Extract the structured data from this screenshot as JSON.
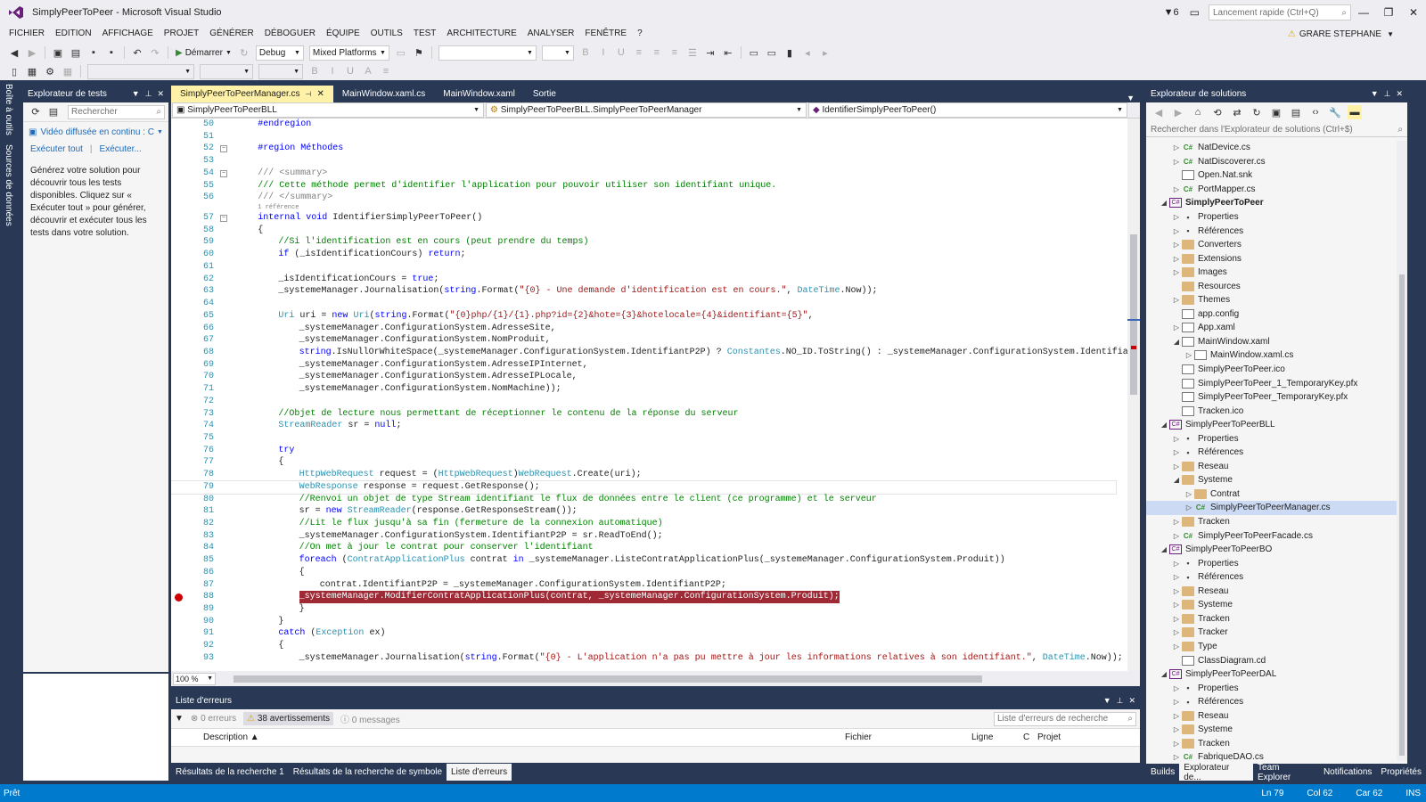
{
  "window": {
    "title": "SimplyPeerToPeer - Microsoft Visual Studio",
    "filter_count": "6",
    "quick_launch": "Lancement rapide (Ctrl+Q)",
    "user": "GRARE STEPHANE"
  },
  "menu": [
    "FICHIER",
    "EDITION",
    "AFFICHAGE",
    "PROJET",
    "GÉNÉRER",
    "DÉBOGUER",
    "ÉQUIPE",
    "OUTILS",
    "TEST",
    "ARCHITECTURE",
    "ANALYSER",
    "FENÊTRE",
    "?"
  ],
  "toolbar": {
    "start_label": "Démarrer",
    "config": "Debug",
    "platform": "Mixed Platforms"
  },
  "side_tabs": [
    "Boîte à outils",
    "Sources de données"
  ],
  "test_explorer": {
    "title": "Explorateur de tests",
    "search_placeholder": "Rechercher",
    "video": "Vidéo diffusée en continu : C",
    "run_all": "Exécuter tout",
    "run": "Exécuter...",
    "description": "Générez votre solution pour découvrir tous les tests disponibles. Cliquez sur « Exécuter tout » pour générer, découvrir et exécuter tous les tests dans votre solution."
  },
  "editor": {
    "tabs": [
      {
        "label": "SimplyPeerToPeerManager.cs",
        "active": true
      },
      {
        "label": "MainWindow.xaml.cs",
        "active": false
      },
      {
        "label": "MainWindow.xaml",
        "active": false
      },
      {
        "label": "Sortie",
        "active": false
      }
    ],
    "nav_project": "SimplyPeerToPeerBLL",
    "nav_class": "SimplyPeerToPeerBLL.SimplyPeerToPeerManager",
    "nav_member": "IdentifierSimplyPeerToPeer()",
    "zoom": "100 %",
    "lines": [
      {
        "n": "50",
        "t": "#endregion",
        "c": "kw",
        "i": 4
      },
      {
        "n": "51",
        "t": "",
        "c": "",
        "i": 0
      },
      {
        "n": "52",
        "t": "#region Méthodes",
        "c": "kw",
        "i": 4,
        "fold": true
      },
      {
        "n": "53",
        "t": "",
        "c": "",
        "i": 0
      },
      {
        "n": "54",
        "t": "/// <summary>",
        "c": "gray",
        "i": 4,
        "fold": true
      },
      {
        "n": "55",
        "t": "/// Cette méthode permet d'identifier l'application pour pouvoir utiliser son identifiant unique.",
        "c": "cmt",
        "i": 4
      },
      {
        "n": "56",
        "t": "/// </summary>",
        "c": "gray",
        "i": 4
      },
      {
        "n": "",
        "t": "1 référence",
        "c": "gray",
        "i": 4,
        "small": true
      },
      {
        "n": "57",
        "t": "internal void IdentifierSimplyPeerToPeer()",
        "c": "",
        "i": 4,
        "fold": true
      },
      {
        "n": "58",
        "t": "{",
        "c": "",
        "i": 4
      },
      {
        "n": "59",
        "t": "//Si l'identification est en cours (peut prendre du temps)",
        "c": "cmt",
        "i": 8
      },
      {
        "n": "60",
        "t": "if (_isIdentificationCours) return;",
        "c": "",
        "i": 8
      },
      {
        "n": "61",
        "t": "",
        "c": "",
        "i": 0
      },
      {
        "n": "62",
        "t": "_isIdentificationCours = true;",
        "c": "",
        "i": 8
      },
      {
        "n": "63",
        "t": "_systemeManager.Journalisation(string.Format(\"{0} - Une demande d'identification est en cours.\", DateTime.Now));",
        "c": "",
        "i": 8
      },
      {
        "n": "64",
        "t": "",
        "c": "",
        "i": 0
      },
      {
        "n": "65",
        "t": "Uri uri = new Uri(string.Format(\"{0}php/{1}/{1}.php?id={2}&hote={3}&hotelocale={4}&identifiant={5}\",",
        "c": "",
        "i": 8
      },
      {
        "n": "66",
        "t": "_systemeManager.ConfigurationSystem.AdresseSite,",
        "c": "",
        "i": 12
      },
      {
        "n": "67",
        "t": "_systemeManager.ConfigurationSystem.NomProduit,",
        "c": "",
        "i": 12
      },
      {
        "n": "68",
        "t": "string.IsNullOrWhiteSpace(_systemeManager.ConfigurationSystem.IdentifiantP2P) ? Constantes.NO_ID.ToString() : _systemeManager.ConfigurationSystem.Identifiant",
        "c": "",
        "i": 12
      },
      {
        "n": "69",
        "t": "_systemeManager.ConfigurationSystem.AdresseIPInternet,",
        "c": "",
        "i": 12
      },
      {
        "n": "70",
        "t": "_systemeManager.ConfigurationSystem.AdresseIPLocale,",
        "c": "",
        "i": 12
      },
      {
        "n": "71",
        "t": "_systemeManager.ConfigurationSystem.NomMachine));",
        "c": "",
        "i": 12
      },
      {
        "n": "72",
        "t": "",
        "c": "",
        "i": 0
      },
      {
        "n": "73",
        "t": "//Objet de lecture nous permettant de réceptionner le contenu de la réponse du serveur",
        "c": "cmt",
        "i": 8
      },
      {
        "n": "74",
        "t": "StreamReader sr = null;",
        "c": "",
        "i": 8
      },
      {
        "n": "75",
        "t": "",
        "c": "",
        "i": 0
      },
      {
        "n": "76",
        "t": "try",
        "c": "kw",
        "i": 8
      },
      {
        "n": "77",
        "t": "{",
        "c": "",
        "i": 8
      },
      {
        "n": "78",
        "t": "HttpWebRequest request = (HttpWebRequest)WebRequest.Create(uri);",
        "c": "",
        "i": 12
      },
      {
        "n": "79",
        "t": "WebResponse response = request.GetResponse();",
        "c": "",
        "i": 12,
        "cur": true
      },
      {
        "n": "80",
        "t": "//Renvoi un objet de type Stream identifiant le flux de données entre le client (ce programme) et le serveur",
        "c": "cmt",
        "i": 12
      },
      {
        "n": "81",
        "t": "sr = new StreamReader(response.GetResponseStream());",
        "c": "",
        "i": 12
      },
      {
        "n": "82",
        "t": "//Lit le flux jusqu'à sa fin (fermeture de la connexion automatique)",
        "c": "cmt",
        "i": 12
      },
      {
        "n": "83",
        "t": "_systemeManager.ConfigurationSystem.IdentifiantP2P = sr.ReadToEnd();",
        "c": "",
        "i": 12
      },
      {
        "n": "84",
        "t": "//On met à jour le contrat pour conserver l'identifiant",
        "c": "cmt",
        "i": 12
      },
      {
        "n": "85",
        "t": "foreach (ContratApplicationPlus contrat in _systemeManager.ListeContratApplicationPlus(_systemeManager.ConfigurationSystem.Produit))",
        "c": "",
        "i": 12
      },
      {
        "n": "86",
        "t": "{",
        "c": "",
        "i": 12
      },
      {
        "n": "87",
        "t": "contrat.IdentifiantP2P = _systemeManager.ConfigurationSystem.IdentifiantP2P;",
        "c": "",
        "i": 16
      },
      {
        "n": "88",
        "t": "_systemeManager.ModifierContratApplicationPlus(contrat, _systemeManager.ConfigurationSystem.Produit);",
        "c": "",
        "i": 12,
        "bp": true
      },
      {
        "n": "89",
        "t": "}",
        "c": "",
        "i": 12
      },
      {
        "n": "90",
        "t": "}",
        "c": "",
        "i": 8
      },
      {
        "n": "91",
        "t": "catch (Exception ex)",
        "c": "",
        "i": 8
      },
      {
        "n": "92",
        "t": "{",
        "c": "",
        "i": 8
      },
      {
        "n": "93",
        "t": "_systemeManager.Journalisation(string.Format(\"{0} - L'application n'a pas pu mettre à jour les informations relatives à son identifiant.\", DateTime.Now));",
        "c": "",
        "i": 12
      }
    ]
  },
  "error_list": {
    "title": "Liste d'erreurs",
    "errors": "0 erreurs",
    "warnings": "38 avertissements",
    "messages": "0 messages",
    "search_placeholder": "Liste d'erreurs de recherche",
    "columns": [
      "Description",
      "Fichier",
      "Ligne",
      "C",
      "Projet"
    ]
  },
  "bottom_tabs": [
    "Résultats de la recherche 1",
    "Résultats de la recherche de symbole",
    "Liste d'erreurs"
  ],
  "solution": {
    "title": "Explorateur de solutions",
    "search_placeholder": "Rechercher dans l'Explorateur de solutions (Ctrl+$)",
    "nodes": [
      {
        "l": "NatDevice.cs",
        "d": 2,
        "icon": "cs",
        "a": "r"
      },
      {
        "l": "NatDiscoverer.cs",
        "d": 2,
        "icon": "cs",
        "a": "r"
      },
      {
        "l": "Open.Nat.snk",
        "d": 2,
        "icon": "file",
        "a": ""
      },
      {
        "l": "PortMapper.cs",
        "d": 2,
        "icon": "cs",
        "a": "r"
      },
      {
        "l": "SimplyPeerToPeer",
        "d": 1,
        "icon": "proj",
        "a": "d",
        "b": true
      },
      {
        "l": "Properties",
        "d": 2,
        "icon": "ref",
        "a": "r"
      },
      {
        "l": "Références",
        "d": 2,
        "icon": "ref",
        "a": "r"
      },
      {
        "l": "Converters",
        "d": 2,
        "icon": "folder",
        "a": "r"
      },
      {
        "l": "Extensions",
        "d": 2,
        "icon": "folder",
        "a": "r"
      },
      {
        "l": "Images",
        "d": 2,
        "icon": "folder",
        "a": "r"
      },
      {
        "l": "Resources",
        "d": 2,
        "icon": "folder",
        "a": ""
      },
      {
        "l": "Themes",
        "d": 2,
        "icon": "folder",
        "a": "r"
      },
      {
        "l": "app.config",
        "d": 2,
        "icon": "file",
        "a": ""
      },
      {
        "l": "App.xaml",
        "d": 2,
        "icon": "file",
        "a": "r"
      },
      {
        "l": "MainWindow.xaml",
        "d": 2,
        "icon": "file",
        "a": "d"
      },
      {
        "l": "MainWindow.xaml.cs",
        "d": 3,
        "icon": "file",
        "a": "r"
      },
      {
        "l": "SimplyPeerToPeer.ico",
        "d": 2,
        "icon": "file",
        "a": ""
      },
      {
        "l": "SimplyPeerToPeer_1_TemporaryKey.pfx",
        "d": 2,
        "icon": "file",
        "a": ""
      },
      {
        "l": "SimplyPeerToPeer_TemporaryKey.pfx",
        "d": 2,
        "icon": "file",
        "a": ""
      },
      {
        "l": "Tracken.ico",
        "d": 2,
        "icon": "file",
        "a": ""
      },
      {
        "l": "SimplyPeerToPeerBLL",
        "d": 1,
        "icon": "proj",
        "a": "d"
      },
      {
        "l": "Properties",
        "d": 2,
        "icon": "ref",
        "a": "r"
      },
      {
        "l": "Références",
        "d": 2,
        "icon": "ref",
        "a": "r"
      },
      {
        "l": "Reseau",
        "d": 2,
        "icon": "folder",
        "a": "r"
      },
      {
        "l": "Systeme",
        "d": 2,
        "icon": "folder",
        "a": "d"
      },
      {
        "l": "Contrat",
        "d": 3,
        "icon": "folder",
        "a": "r"
      },
      {
        "l": "SimplyPeerToPeerManager.cs",
        "d": 3,
        "icon": "cs",
        "a": "r",
        "sel": true
      },
      {
        "l": "Tracken",
        "d": 2,
        "icon": "folder",
        "a": "r"
      },
      {
        "l": "SimplyPeerToPeerFacade.cs",
        "d": 2,
        "icon": "cs",
        "a": "r"
      },
      {
        "l": "SimplyPeerToPeerBO",
        "d": 1,
        "icon": "proj",
        "a": "d"
      },
      {
        "l": "Properties",
        "d": 2,
        "icon": "ref",
        "a": "r"
      },
      {
        "l": "Références",
        "d": 2,
        "icon": "ref",
        "a": "r"
      },
      {
        "l": "Reseau",
        "d": 2,
        "icon": "folder",
        "a": "r"
      },
      {
        "l": "Systeme",
        "d": 2,
        "icon": "folder",
        "a": "r"
      },
      {
        "l": "Tracken",
        "d": 2,
        "icon": "folder",
        "a": "r"
      },
      {
        "l": "Tracker",
        "d": 2,
        "icon": "folder",
        "a": "r"
      },
      {
        "l": "Type",
        "d": 2,
        "icon": "folder",
        "a": "r"
      },
      {
        "l": "ClassDiagram.cd",
        "d": 2,
        "icon": "file",
        "a": ""
      },
      {
        "l": "SimplyPeerToPeerDAL",
        "d": 1,
        "icon": "proj",
        "a": "d"
      },
      {
        "l": "Properties",
        "d": 2,
        "icon": "ref",
        "a": "r"
      },
      {
        "l": "Références",
        "d": 2,
        "icon": "ref",
        "a": "r"
      },
      {
        "l": "Reseau",
        "d": 2,
        "icon": "folder",
        "a": "r"
      },
      {
        "l": "Systeme",
        "d": 2,
        "icon": "folder",
        "a": "r"
      },
      {
        "l": "Tracken",
        "d": 2,
        "icon": "folder",
        "a": "r"
      },
      {
        "l": "FabriqueDAO.cs",
        "d": 2,
        "icon": "cs",
        "a": "r"
      }
    ],
    "tabs": [
      "Builds",
      "Explorateur de...",
      "Team Explorer",
      "Notifications",
      "Propriétés"
    ]
  },
  "status": {
    "left": "Prêt",
    "line": "Ln 79",
    "col": "Col 62",
    "car": "Car 62",
    "mode": "INS"
  }
}
